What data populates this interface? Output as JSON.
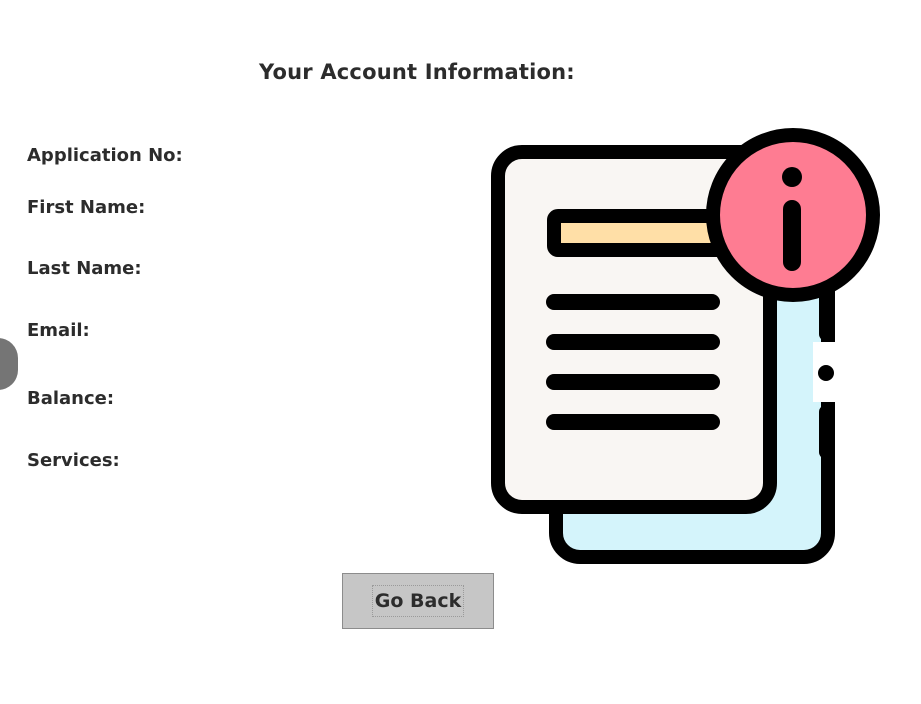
{
  "page": {
    "title": "Your Account Information:"
  },
  "fields": {
    "application_no_label": "Application No:",
    "first_name_label": "First Name:",
    "last_name_label": "Last Name:",
    "email_label": "Email:",
    "balance_label": "Balance:",
    "services_label": "Services:"
  },
  "actions": {
    "go_back_label": "Go Back"
  },
  "illustration": {
    "icon": "document-info-icon",
    "colors": {
      "outline": "#000000",
      "paper": "#f9f6f3",
      "back_paper": "#d4f4fb",
      "highlight": "#ffdfa7",
      "info_circle": "#fe7c92"
    }
  }
}
